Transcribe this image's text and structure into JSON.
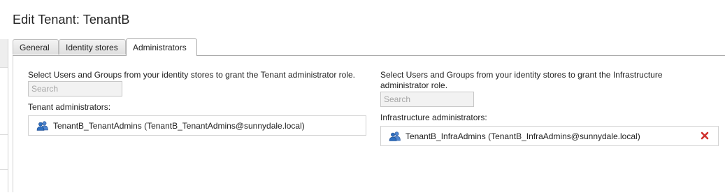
{
  "page": {
    "title": "Edit Tenant: TenantB"
  },
  "tabs": [
    {
      "label": "General"
    },
    {
      "label": "Identity stores"
    },
    {
      "label": "Administrators",
      "active": true
    }
  ],
  "tenant_admins": {
    "instruction": "Select Users and Groups from your identity stores to grant the Tenant administrator role.",
    "search_placeholder": "Search",
    "search_value": "",
    "list_label": "Tenant administrators:",
    "items": [
      {
        "text": "TenantB_TenantAdmins (TenantB_TenantAdmins@sunnydale.local)",
        "icon": "user-group-icon"
      }
    ]
  },
  "infra_admins": {
    "instruction_line1": "Select Users and Groups from your identity stores to grant the Infrastructure",
    "instruction_line2": "administrator role.",
    "search_placeholder": "Search",
    "search_value": "",
    "list_label": "Infrastructure administrators:",
    "items": [
      {
        "text": "TenantB_InfraAdmins (TenantB_InfraAdmins@sunnydale.local)",
        "icon": "user-group-icon",
        "remove_icon": "remove-icon"
      }
    ]
  },
  "colors": {
    "remove": "#d0312d",
    "icon_blue": "#2e6fc0",
    "tab_border": "#a9a9a9"
  }
}
